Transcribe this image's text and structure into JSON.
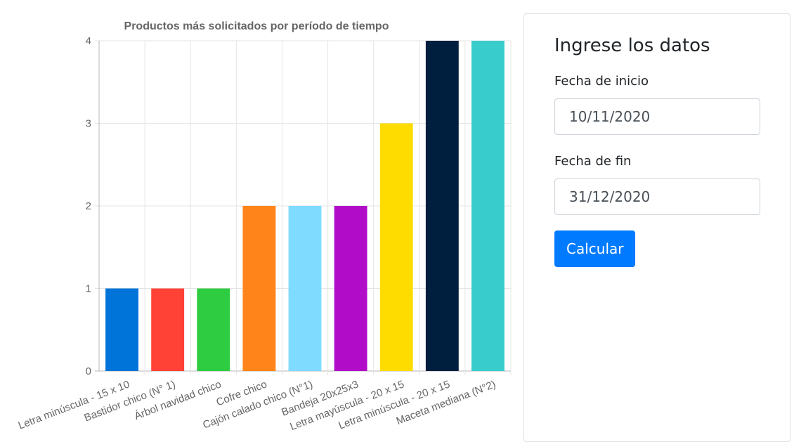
{
  "chart_data": {
    "type": "bar",
    "title": "Productos más solicitados por período de tiempo",
    "categories": [
      "Letra minúscula - 15 x 10",
      "Bastidor chico (N° 1)",
      "Árbol navidad chico",
      "Cofre chico",
      "Cajón calado chico (N°1)",
      "Bandeja 20x25x3",
      "Letra mayúscula - 20 x 15",
      "Letra minúscula - 20 x 15",
      "Maceta mediana (N°2)"
    ],
    "values": [
      1,
      1,
      1,
      2,
      2,
      2,
      3,
      4,
      4
    ],
    "colors": [
      "#0074d9",
      "#ff4136",
      "#2ecc40",
      "#ff851b",
      "#7fdbff",
      "#b10dc9",
      "#ffdc00",
      "#001f3f",
      "#39cccc"
    ],
    "ylim": [
      0,
      4
    ],
    "yticks": [
      "0",
      "1",
      "2",
      "3",
      "4"
    ],
    "grid": true
  },
  "form": {
    "title": "Ingrese los datos",
    "start_label": "Fecha de inicio",
    "start_value": "10/11/2020",
    "end_label": "Fecha de fin",
    "end_value": "31/12/2020",
    "submit_label": "Calcular"
  }
}
